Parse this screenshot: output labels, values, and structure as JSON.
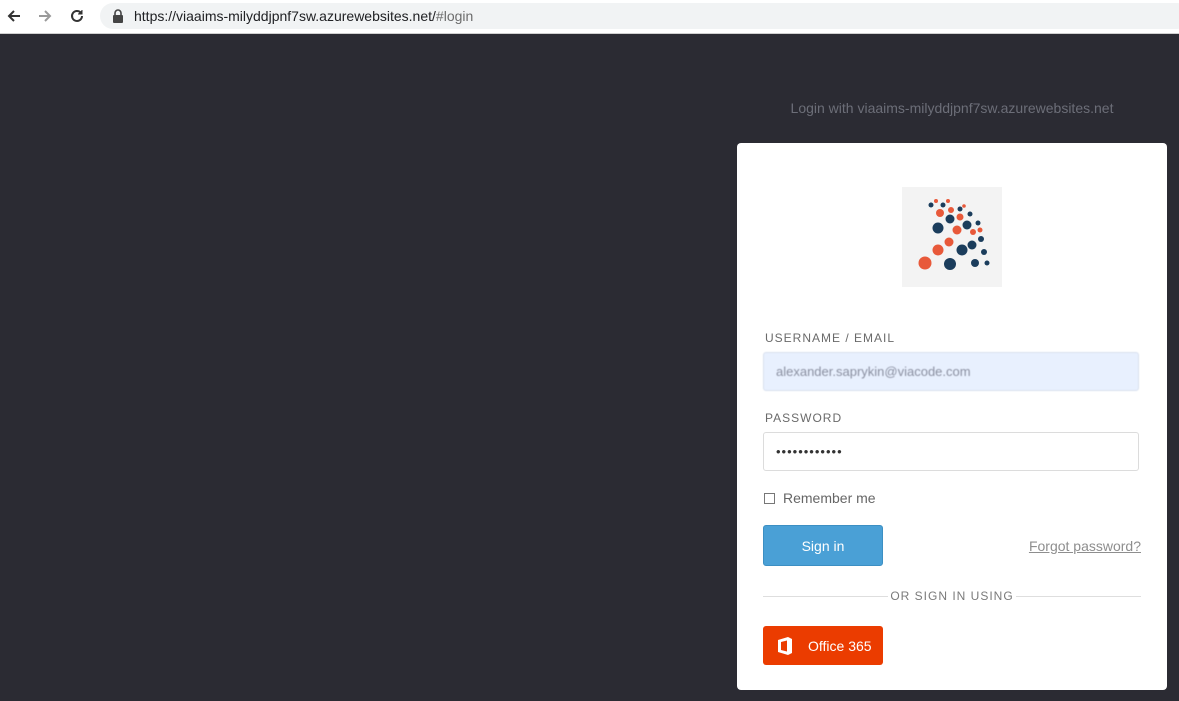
{
  "browser": {
    "url_main": "https://viaaims-milyddjpnf7sw.azurewebsites.net/",
    "url_fragment": "#login"
  },
  "page": {
    "login_with": "Login with viaaims-milyddjpnf7sw.azurewebsites.net"
  },
  "form": {
    "username_label": "USERNAME / EMAIL",
    "username_value": "alexander.saprykin@viacode.com",
    "password_label": "PASSWORD",
    "password_value": "••••••••••••",
    "remember_label": "Remember me",
    "signin_label": "Sign in",
    "forgot_label": "Forgot password?",
    "or_sign_in_using": "OR SIGN IN USING",
    "office_label": "Office 365"
  },
  "colors": {
    "background": "#2b2b33",
    "signin_button": "#4aa0d6",
    "office_button": "#eb3c00",
    "logo_navy": "#1b3d5c",
    "logo_orange": "#e8593a"
  }
}
